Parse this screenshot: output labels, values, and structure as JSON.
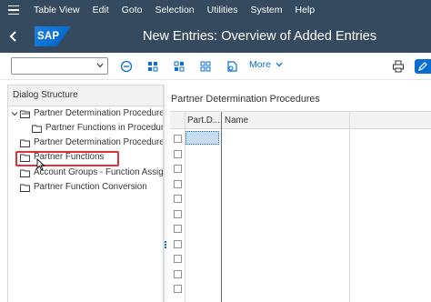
{
  "menu": {
    "items": [
      "Table View",
      "Edit",
      "Goto",
      "Selection",
      "Utilities",
      "System",
      "Help"
    ]
  },
  "shell": {
    "logo_text": "SAP",
    "title": "New Entries: Overview of Added Entries"
  },
  "toolbar": {
    "command_field_value": "",
    "more_label": "More",
    "icons": [
      "cancel-icon",
      "select-all-icon",
      "select-block-icon",
      "deselect-all-icon",
      "export-icon",
      "print-icon",
      "display-change-icon"
    ]
  },
  "dialog_structure": {
    "header": "Dialog Structure",
    "items": [
      {
        "label": "Partner Determination Procedures",
        "level": 0,
        "expanded": true
      },
      {
        "label": "Partner Functions in Procedure",
        "level": 1
      },
      {
        "label": "Partner Determination Procedure A",
        "level": 0
      },
      {
        "label": "Partner Functions",
        "level": 0,
        "selected": true
      },
      {
        "label": "Account Groups - Function Assignm",
        "level": 0
      },
      {
        "label": "Partner Function Conversion",
        "level": 0
      }
    ]
  },
  "table": {
    "title": "Partner Determination Procedures",
    "columns": [
      "Part.D...",
      "Name"
    ],
    "row_count": 11
  },
  "colors": {
    "shell_bg": "#354a5f",
    "accent": "#0a6ed1",
    "highlight": "#e0303a",
    "selected_bg": "#fbf3cf"
  }
}
